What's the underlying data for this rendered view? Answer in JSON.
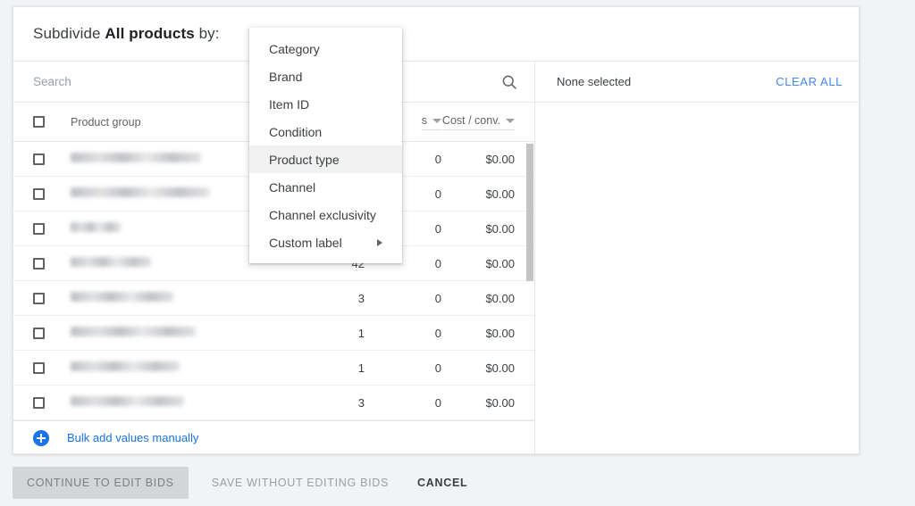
{
  "header": {
    "prefix": "Subdivide ",
    "emphasis": "All products",
    "suffix": " by:"
  },
  "search": {
    "placeholder": "Search",
    "value": "",
    "icon": "search-icon"
  },
  "table": {
    "columns": [
      {
        "key": "name",
        "label": "Product group",
        "sortable": false
      },
      {
        "key": "num",
        "label": "",
        "sortable": true
      },
      {
        "key": "conv",
        "label": "s",
        "sortable": true
      },
      {
        "key": "cost",
        "label": "Cost / conv.",
        "sortable": true
      }
    ],
    "rows": [
      {
        "name": "",
        "redacted": true,
        "name_width": 146,
        "num": "",
        "conv": "0",
        "cost": "$0.00"
      },
      {
        "name": "",
        "redacted": true,
        "name_width": 155,
        "num": "",
        "conv": "0",
        "cost": "$0.00"
      },
      {
        "name": "",
        "redacted": true,
        "name_width": 56,
        "num": "",
        "conv": "0",
        "cost": "$0.00"
      },
      {
        "name": "",
        "redacted": true,
        "name_width": 90,
        "num": "42",
        "conv": "0",
        "cost": "$0.00"
      },
      {
        "name": "",
        "redacted": true,
        "name_width": 115,
        "num": "3",
        "conv": "0",
        "cost": "$0.00"
      },
      {
        "name": "",
        "redacted": true,
        "name_width": 140,
        "num": "1",
        "conv": "0",
        "cost": "$0.00"
      },
      {
        "name": "",
        "redacted": true,
        "name_width": 122,
        "num": "1",
        "conv": "0",
        "cost": "$0.00"
      },
      {
        "name": "",
        "redacted": true,
        "name_width": 127,
        "num": "3",
        "conv": "0",
        "cost": "$0.00"
      }
    ]
  },
  "bulk_add": {
    "label": "Bulk add values manually",
    "icon": "plus-circle-icon"
  },
  "selection_panel": {
    "status": "None selected",
    "clear_all": "CLEAR ALL"
  },
  "actions": {
    "continue": "CONTINUE TO EDIT BIDS",
    "save": "SAVE WITHOUT EDITING BIDS",
    "cancel": "CANCEL"
  },
  "dropdown": {
    "items": [
      {
        "label": "Category",
        "highlighted": false,
        "submenu": false
      },
      {
        "label": "Brand",
        "highlighted": false,
        "submenu": false
      },
      {
        "label": "Item ID",
        "highlighted": false,
        "submenu": false
      },
      {
        "label": "Condition",
        "highlighted": false,
        "submenu": false
      },
      {
        "label": "Product type",
        "highlighted": true,
        "submenu": false
      },
      {
        "label": "Channel",
        "highlighted": false,
        "submenu": false
      },
      {
        "label": "Channel exclusivity",
        "highlighted": false,
        "submenu": false
      },
      {
        "label": "Custom label",
        "highlighted": false,
        "submenu": true
      }
    ]
  },
  "colors": {
    "accent_blue": "#1a73e8",
    "link_blue": "#4285f4",
    "text_primary": "#3c4043",
    "page_bg": "#f1f3f4",
    "highlight": "#f1f1f1"
  }
}
